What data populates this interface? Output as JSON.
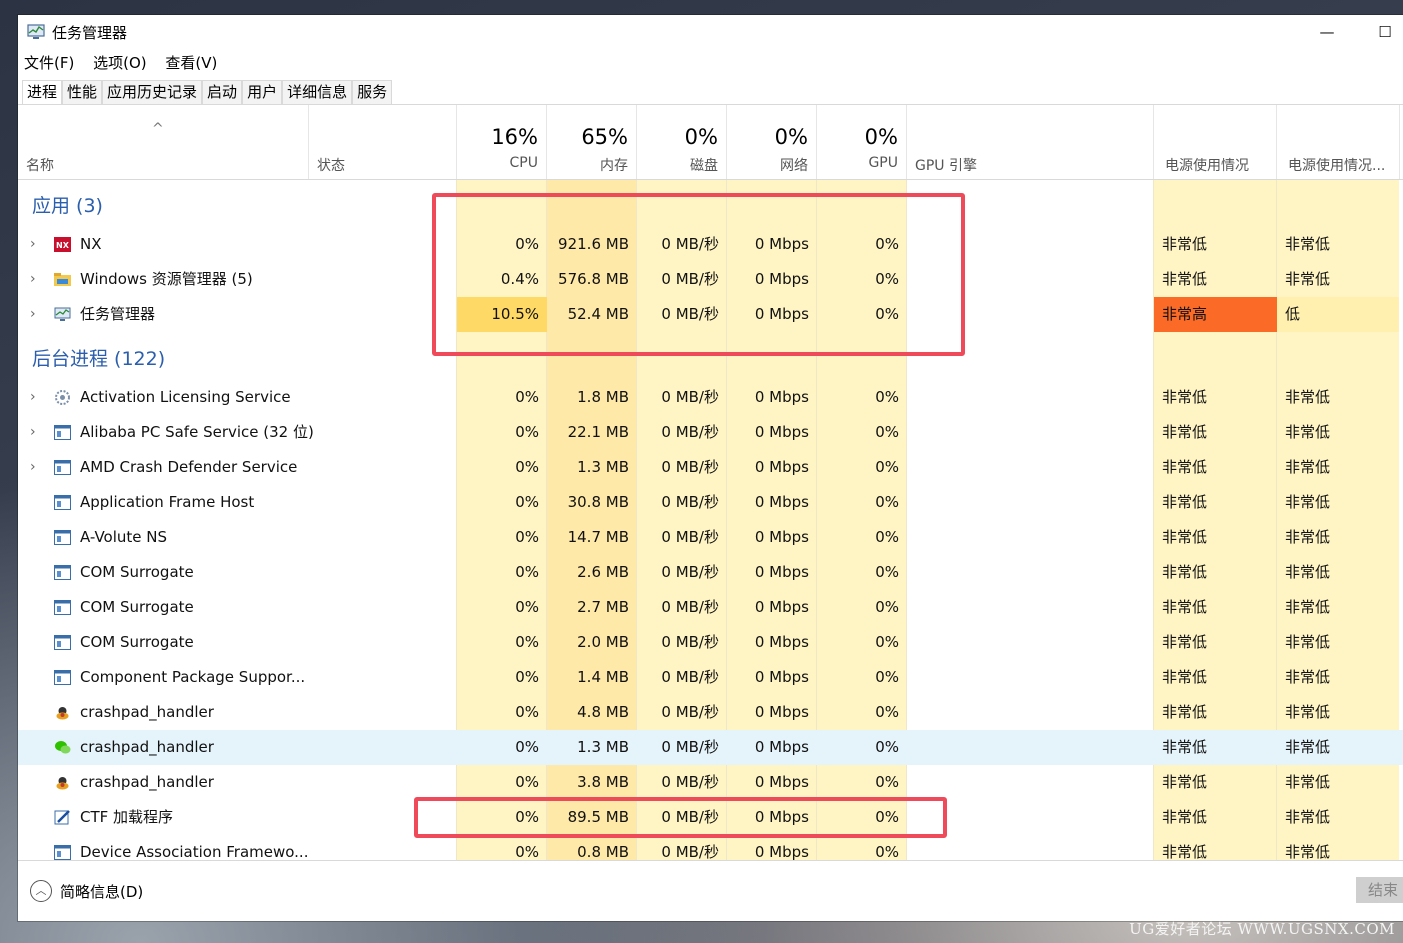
{
  "window": {
    "title": "任务管理器"
  },
  "controls": {
    "minimize": "—",
    "maximize": "☐"
  },
  "menu": [
    "文件(F)",
    "选项(O)",
    "查看(V)"
  ],
  "tabs": [
    "进程",
    "性能",
    "应用历史记录",
    "启动",
    "用户",
    "详细信息",
    "服务"
  ],
  "header": {
    "name": "名称",
    "status": "状态",
    "cpu": {
      "pct": "16%",
      "label": "CPU"
    },
    "mem": {
      "pct": "65%",
      "label": "内存"
    },
    "disk": {
      "pct": "0%",
      "label": "磁盘"
    },
    "net": {
      "pct": "0%",
      "label": "网络"
    },
    "gpu": {
      "pct": "0%",
      "label": "GPU"
    },
    "gpu_engine": "GPU 引擎",
    "power": "电源使用情况",
    "power_trend": "电源使用情况..."
  },
  "groups": {
    "apps": "应用 (3)",
    "background": "后台进程 (122)"
  },
  "apps": [
    {
      "name": "NX",
      "icon": "nx-icon",
      "cpu": "0%",
      "mem": "921.6 MB",
      "disk": "0 MB/秒",
      "net": "0 Mbps",
      "gpu": "0%",
      "power": "非常低",
      "trend": "非常低",
      "expandable": true
    },
    {
      "name": "Windows 资源管理器 (5)",
      "icon": "folder-icon",
      "cpu": "0.4%",
      "mem": "576.8 MB",
      "disk": "0 MB/秒",
      "net": "0 Mbps",
      "gpu": "0%",
      "power": "非常低",
      "trend": "非常低",
      "expandable": true
    },
    {
      "name": "任务管理器",
      "icon": "task-manager-icon",
      "cpu": "10.5%",
      "mem": "52.4 MB",
      "disk": "0 MB/秒",
      "net": "0 Mbps",
      "gpu": "0%",
      "power": "非常高",
      "trend": "低",
      "expandable": true
    }
  ],
  "background": [
    {
      "name": "Activation Licensing Service",
      "icon": "service-gear-icon",
      "cpu": "0%",
      "mem": "1.8 MB",
      "disk": "0 MB/秒",
      "net": "0 Mbps",
      "gpu": "0%",
      "power": "非常低",
      "trend": "非常低",
      "expandable": true
    },
    {
      "name": "Alibaba PC Safe Service (32 位)",
      "icon": "window-app-icon",
      "cpu": "0%",
      "mem": "22.1 MB",
      "disk": "0 MB/秒",
      "net": "0 Mbps",
      "gpu": "0%",
      "power": "非常低",
      "trend": "非常低",
      "expandable": true
    },
    {
      "name": "AMD Crash Defender Service",
      "icon": "window-app-icon",
      "cpu": "0%",
      "mem": "1.3 MB",
      "disk": "0 MB/秒",
      "net": "0 Mbps",
      "gpu": "0%",
      "power": "非常低",
      "trend": "非常低",
      "expandable": true
    },
    {
      "name": "Application Frame Host",
      "icon": "window-app-icon",
      "cpu": "0%",
      "mem": "30.8 MB",
      "disk": "0 MB/秒",
      "net": "0 Mbps",
      "gpu": "0%",
      "power": "非常低",
      "trend": "非常低",
      "expandable": false
    },
    {
      "name": "A-Volute NS",
      "icon": "window-app-icon",
      "cpu": "0%",
      "mem": "14.7 MB",
      "disk": "0 MB/秒",
      "net": "0 Mbps",
      "gpu": "0%",
      "power": "非常低",
      "trend": "非常低",
      "expandable": false
    },
    {
      "name": "COM Surrogate",
      "icon": "window-app-icon",
      "cpu": "0%",
      "mem": "2.6 MB",
      "disk": "0 MB/秒",
      "net": "0 Mbps",
      "gpu": "0%",
      "power": "非常低",
      "trend": "非常低",
      "expandable": false
    },
    {
      "name": "COM Surrogate",
      "icon": "window-app-icon",
      "cpu": "0%",
      "mem": "2.7 MB",
      "disk": "0 MB/秒",
      "net": "0 Mbps",
      "gpu": "0%",
      "power": "非常低",
      "trend": "非常低",
      "expandable": false
    },
    {
      "name": "COM Surrogate",
      "icon": "window-app-icon",
      "cpu": "0%",
      "mem": "2.0 MB",
      "disk": "0 MB/秒",
      "net": "0 Mbps",
      "gpu": "0%",
      "power": "非常低",
      "trend": "非常低",
      "expandable": false
    },
    {
      "name": "Component Package Suppor...",
      "icon": "window-app-icon",
      "cpu": "0%",
      "mem": "1.4 MB",
      "disk": "0 MB/秒",
      "net": "0 Mbps",
      "gpu": "0%",
      "power": "非常低",
      "trend": "非常低",
      "expandable": false
    },
    {
      "name": "crashpad_handler",
      "icon": "crashpad-icon",
      "cpu": "0%",
      "mem": "4.8 MB",
      "disk": "0 MB/秒",
      "net": "0 Mbps",
      "gpu": "0%",
      "power": "非常低",
      "trend": "非常低",
      "expandable": false
    },
    {
      "name": "crashpad_handler",
      "icon": "wechat-icon",
      "cpu": "0%",
      "mem": "1.3 MB",
      "disk": "0 MB/秒",
      "net": "0 Mbps",
      "gpu": "0%",
      "power": "非常低",
      "trend": "非常低",
      "expandable": false,
      "selected": true
    },
    {
      "name": "crashpad_handler",
      "icon": "crashpad-icon",
      "cpu": "0%",
      "mem": "3.8 MB",
      "disk": "0 MB/秒",
      "net": "0 Mbps",
      "gpu": "0%",
      "power": "非常低",
      "trend": "非常低",
      "expandable": false
    },
    {
      "name": "CTF 加载程序",
      "icon": "ctf-pen-icon",
      "cpu": "0%",
      "mem": "89.5 MB",
      "disk": "0 MB/秒",
      "net": "0 Mbps",
      "gpu": "0%",
      "power": "非常低",
      "trend": "非常低",
      "expandable": false
    },
    {
      "name": "Device Association Framewo...",
      "icon": "window-app-icon",
      "cpu": "0%",
      "mem": "0.8 MB",
      "disk": "0 MB/秒",
      "net": "0 Mbps",
      "gpu": "0%",
      "power": "非常低",
      "trend": "非常低",
      "expandable": false
    }
  ],
  "colors": {
    "cpu_col": "#fff4c4",
    "mem_col": "#ffe9a8",
    "light_col": "#fff4c4",
    "cpu_high": "#ffd966",
    "power_high": "#fc6a27",
    "power_trend_low": "#fff0b0",
    "group_title": "#2b5fad",
    "highlight": "#ef4a5a"
  },
  "footer": {
    "fewer_details": "简略信息(D)",
    "end_task": "结束"
  },
  "watermark": "UG爱好者论坛 WWW.UGSNX.COM"
}
